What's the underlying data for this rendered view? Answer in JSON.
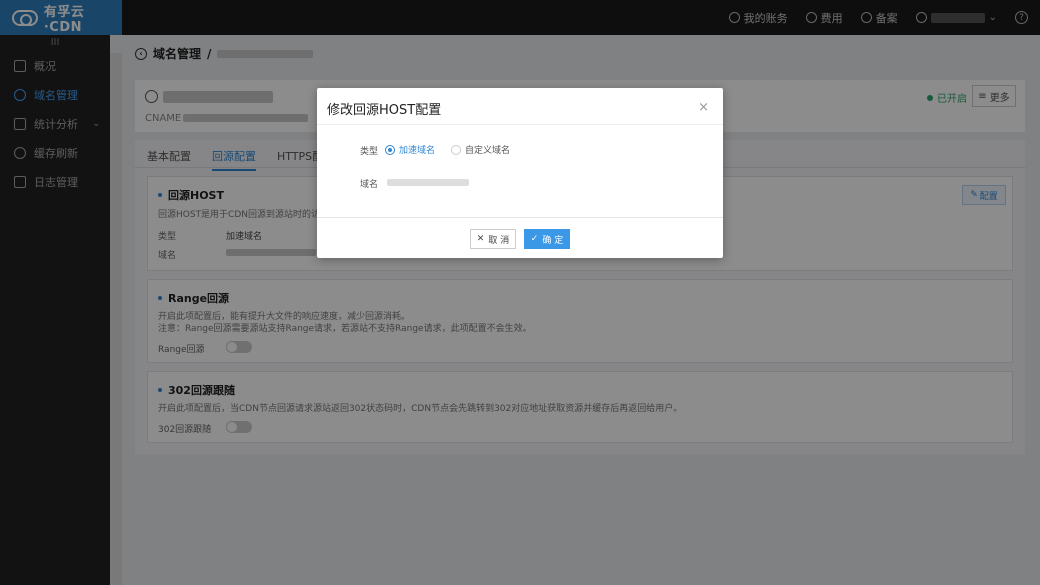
{
  "brand": {
    "name": "有孚云·CDN"
  },
  "topbar": {
    "items": [
      {
        "label": "我的账务",
        "icon": "account-icon"
      },
      {
        "label": "费用",
        "icon": "cost-icon"
      },
      {
        "label": "备案",
        "icon": "record-icon"
      }
    ],
    "help": "?"
  },
  "sidebar": {
    "collapse": "III",
    "items": [
      {
        "label": "概况",
        "icon": "cube-icon"
      },
      {
        "label": "域名管理",
        "icon": "globe-icon",
        "active": true
      },
      {
        "label": "统计分析",
        "icon": "chart-icon",
        "caret": "⌄"
      },
      {
        "label": "缓存刷新",
        "icon": "refresh-icon"
      },
      {
        "label": "日志管理",
        "icon": "log-icon"
      }
    ]
  },
  "breadcrumb": {
    "root": "域名管理",
    "sep": "/"
  },
  "domain_card": {
    "cname_label": "CNAME",
    "status": "已开启",
    "more": "更多"
  },
  "tabs": [
    "基本配置",
    "回源配置",
    "HTTPS配"
  ],
  "sections": {
    "host": {
      "title": "回源HOST",
      "desc": "回源HOST是用于CDN回源到源站时的访问域",
      "type_label": "类型",
      "type_value": "加速域名",
      "domain_label": "域名",
      "config_btn": "配置"
    },
    "range": {
      "title": "Range回源",
      "desc1": "开启此项配置后，能有提升大文件的响应速度，减少回源消耗。",
      "desc2": "注意：Range回源需要源站支持Range请求，若源站不支持Range请求，此项配置不会生效。",
      "switch_label": "Range回源"
    },
    "redirect": {
      "title": "302回源跟随",
      "desc": "开启此项配置后，当CDN节点回源请求源站返回302状态码时，CDN节点会先跳转到302对应地址获取资源并缓存后再返回给用户。",
      "switch_label": "302回源跟随"
    }
  },
  "modal": {
    "title": "修改回源HOST配置",
    "close": "×",
    "type_label": "类型",
    "options": [
      "加速域名",
      "自定义域名"
    ],
    "selected": "加速域名",
    "domain_label": "域名",
    "cancel": "取 消",
    "ok": "确 定"
  }
}
